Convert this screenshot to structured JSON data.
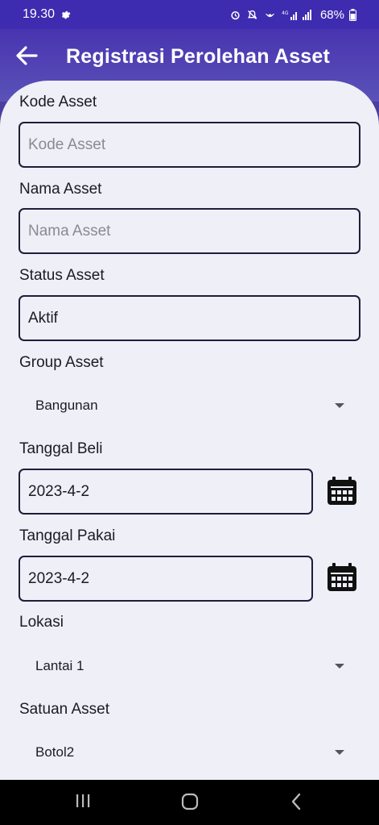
{
  "status_bar": {
    "time": "19.30",
    "battery": "68%"
  },
  "header": {
    "title": "Registrasi Perolehan Asset"
  },
  "form": {
    "kode_asset": {
      "label": "Kode Asset",
      "placeholder": "Kode Asset",
      "value": ""
    },
    "nama_asset": {
      "label": "Nama Asset",
      "placeholder": "Nama Asset",
      "value": ""
    },
    "status_asset": {
      "label": "Status Asset",
      "value": "Aktif"
    },
    "group_asset": {
      "label": "Group Asset",
      "selected": "Bangunan"
    },
    "tanggal_beli": {
      "label": "Tanggal Beli",
      "value": "2023-4-2"
    },
    "tanggal_pakai": {
      "label": "Tanggal Pakai",
      "value": "2023-4-2"
    },
    "lokasi": {
      "label": "Lokasi",
      "selected": "Lantai 1"
    },
    "satuan_asset": {
      "label": "Satuan Asset",
      "selected": "Botol2"
    }
  },
  "icons": {
    "back": "arrow-left-icon",
    "calendar": "calendar-icon",
    "dropdown": "caret-down-icon",
    "nav_recents": "recent-apps-icon",
    "nav_home": "home-icon",
    "nav_back": "chevron-left-icon"
  },
  "colors": {
    "app_bar": "#4834b0",
    "content_bg": "#efeff8",
    "field_border": "#1f1d3a"
  }
}
